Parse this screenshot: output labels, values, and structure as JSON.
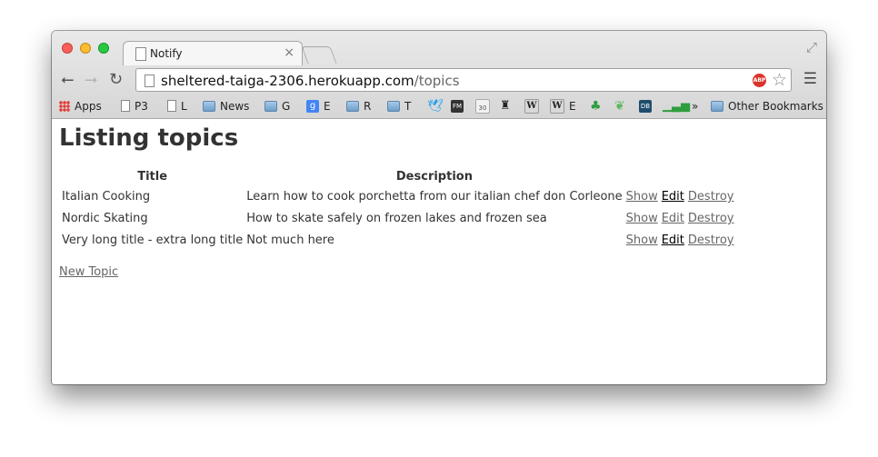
{
  "browser": {
    "tab_title": "Notify",
    "tab_close": "×",
    "url_host": "sheltered-taiga-2306.herokuapp.com",
    "url_path": "/topics",
    "abp_label": "ABP",
    "bookmarks": [
      {
        "label": "Apps",
        "icon": "apps-grid-icon"
      },
      {
        "label": "P3",
        "icon": "page-icon"
      },
      {
        "label": "L",
        "icon": "page-icon"
      },
      {
        "label": "News",
        "icon": "folder-icon"
      },
      {
        "label": "G",
        "icon": "folder-icon"
      },
      {
        "label": "E",
        "icon": "google-plus-icon"
      },
      {
        "label": "R",
        "icon": "folder-icon"
      },
      {
        "label": "T",
        "icon": "folder-icon"
      },
      {
        "label": "",
        "icon": "twitter-icon"
      },
      {
        "label": "",
        "icon": "fm-icon"
      },
      {
        "label": "",
        "icon": "calendar-30-icon"
      },
      {
        "label": "",
        "icon": "robot-icon"
      },
      {
        "label": "",
        "icon": "wikipedia-icon"
      },
      {
        "label": "E",
        "icon": "wikipedia-icon"
      },
      {
        "label": "",
        "icon": "clover-icon"
      },
      {
        "label": "",
        "icon": "leaf-icon"
      },
      {
        "label": "",
        "icon": "db-icon"
      },
      {
        "label": "",
        "icon": "signal-bars-icon"
      }
    ],
    "overflow_chevron": "»",
    "other_bookmarks": "Other Bookmarks"
  },
  "page": {
    "heading": "Listing topics",
    "columns": [
      "Title",
      "Description"
    ],
    "rows": [
      {
        "title": "Italian Cooking",
        "description": "Learn how to cook porchetta from our italian chef don Corleone",
        "show": "Show",
        "edit": "Edit",
        "destroy": "Destroy"
      },
      {
        "title": "Nordic Skating",
        "description": "How to skate safely on frozen lakes and frozen sea",
        "show": "Show",
        "edit": "Edit",
        "destroy": "Destroy"
      },
      {
        "title": "Very long title - extra long title",
        "description": "Not much here",
        "show": "Show",
        "edit": "Edit",
        "destroy": "Destroy"
      }
    ],
    "new_link": "New Topic"
  },
  "colors": {
    "link": "#666666",
    "edit_link": "#000000",
    "heading": "#333333"
  }
}
